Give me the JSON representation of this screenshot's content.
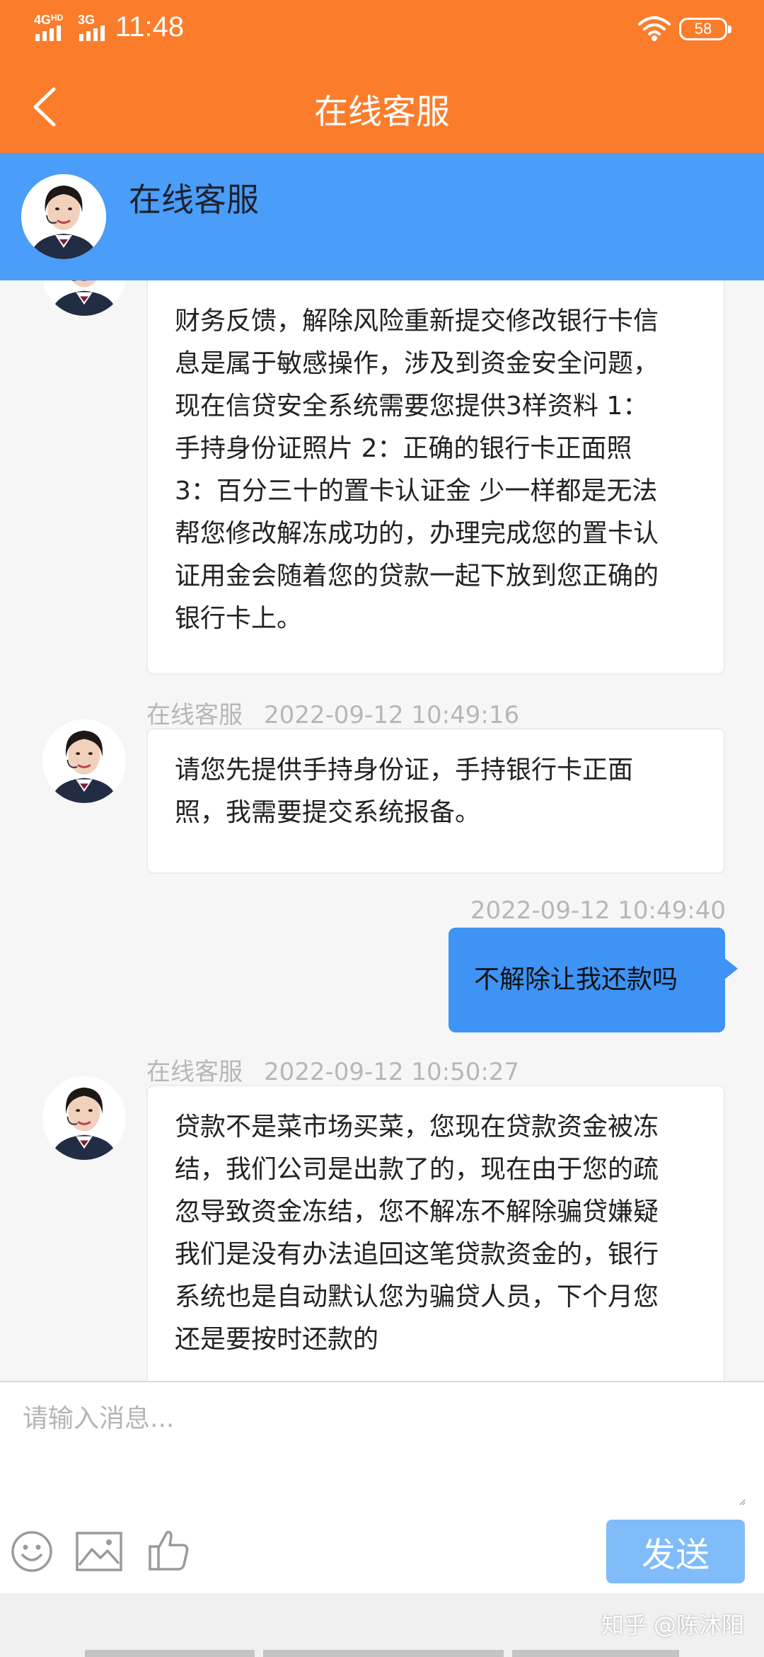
{
  "status_bar": {
    "time": "11:48",
    "network_1": "4G",
    "network_1_sup": "HD",
    "network_2": "3G",
    "battery": "58",
    "wifi_icon": "wifi-icon"
  },
  "title_bar": {
    "title": "在线客服",
    "back_icon": "chevron-left-icon"
  },
  "agent": {
    "name": "在线客服"
  },
  "messages": [
    {
      "sender": "agent",
      "author": "",
      "time": "",
      "lines": [
        "财务反馈，解除风险重新提交修改银行卡信",
        "息是属于敏感操作，涉及到资金安全问题，",
        "现在信贷安全系统需要您提供3样资料 1：",
        "手持身份证照片 2：正确的银行卡正面照",
        "3：百分三十的置卡认证金 少一样都是无法",
        "帮您修改解冻成功的，办理完成您的置卡认",
        "证用金会随着您的贷款一起下放到您正确的",
        "银行卡上。"
      ]
    },
    {
      "sender": "agent",
      "author": "在线客服",
      "time": "2022-09-12 10:49:16",
      "lines": [
        "请您先提供手持身份证，手持银行卡正面",
        "照，我需要提交系统报备。"
      ]
    },
    {
      "sender": "user",
      "author": "",
      "time": "2022-09-12 10:49:40",
      "lines": [
        "不解除让我还款吗"
      ]
    },
    {
      "sender": "agent",
      "author": "在线客服",
      "time": "2022-09-12 10:50:27",
      "lines": [
        "贷款不是菜市场买菜，您现在贷款资金被冻",
        "结，我们公司是出款了的，现在由于您的疏",
        "忽导致资金冻结，您不解冻不解除骗贷嫌疑",
        "我们是没有办法追回这笔贷款资金的，银行",
        "系统也是自动默认您为骗贷人员，下个月您",
        "还是要按时还款的"
      ]
    }
  ],
  "input": {
    "placeholder": "请输入消息...",
    "value": ""
  },
  "toolbar": {
    "icons": [
      "emoji-icon",
      "image-icon",
      "thumbs-up-icon"
    ],
    "send_label": "发送"
  },
  "watermark": "知乎 @陈沐阳",
  "colors": {
    "title_bar": "#fb7d2c",
    "agent_header": "#4a9df8",
    "user_bubble": "#3e93f5",
    "send_button": "#7fbcf9"
  }
}
